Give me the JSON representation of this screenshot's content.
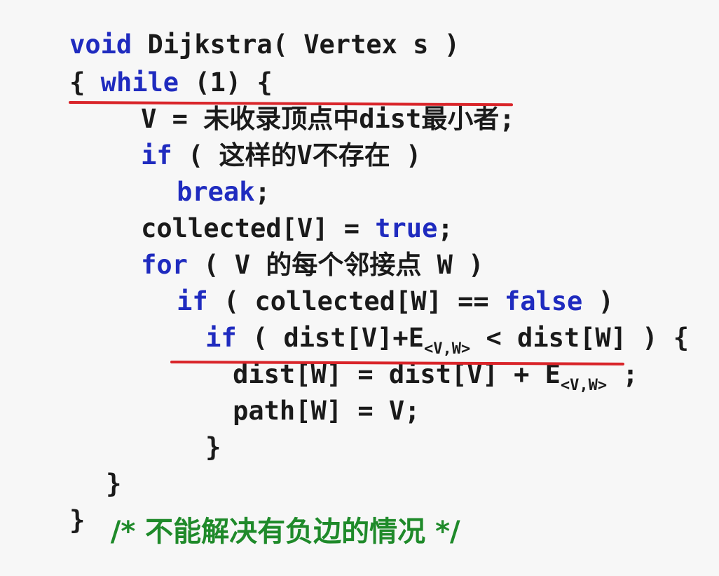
{
  "code": {
    "l1": {
      "kw": "void",
      "rest": " Dijkstra( Vertex s )"
    },
    "l2": {
      "open": "{ ",
      "kw": "while",
      "rest": " (1) {"
    },
    "l3": {
      "text": "V = 未收录顶点中dist最小者;"
    },
    "l4": {
      "kw": "if",
      "rest": " ( 这样的V不存在 )"
    },
    "l5": {
      "kw": "break",
      "rest": ";"
    },
    "l6": {
      "pre": "collected[V] = ",
      "kw": "true",
      "rest": ";"
    },
    "l7": {
      "kw": "for",
      "rest": " ( V 的每个邻接点 W )"
    },
    "l8": {
      "kw": "if",
      "mid": " ( collected[W] == ",
      "kw2": "false",
      "rest": " )"
    },
    "l9": {
      "kw": "if",
      "pre": " ( dist[V]+E",
      "sub": "<V,W>",
      "rest": " < dist[W] ) {"
    },
    "l10": {
      "pre": "dist[W] = dist[V] + E",
      "sub": "<V,W>",
      "rest": " ;"
    },
    "l11": {
      "text": "path[W] = V;"
    },
    "l12": {
      "text": "}"
    },
    "l13": {
      "text": "}"
    },
    "l14": {
      "text": "}"
    },
    "comment": "/* 不能解决有负边的情况 */"
  },
  "colors": {
    "keyword": "#1f2bbf",
    "comment": "#1f8a2a",
    "underline": "#d9252a",
    "text": "#1a1a1a"
  }
}
